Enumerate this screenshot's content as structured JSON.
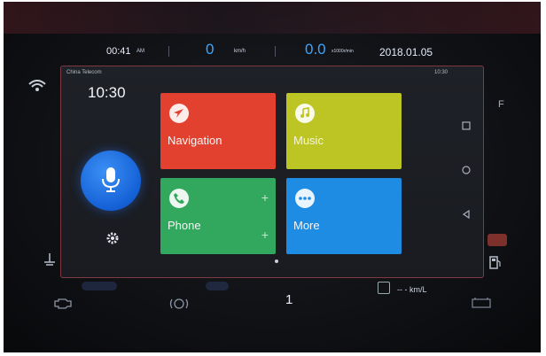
{
  "cluster": {
    "time": "00:41",
    "ampm": "AM",
    "speed": "0",
    "speed_unit": "km/h",
    "rpm": "0.0",
    "rpm_unit": "x1000r/min",
    "date": "2018.01.05"
  },
  "screen": {
    "status_left": "China Telecom",
    "status_right": "10:30",
    "clock": "10:30"
  },
  "tiles": [
    {
      "label": "Navigation",
      "icon": "navigation-arrow-icon",
      "color": "#e2412f"
    },
    {
      "label": "Music",
      "icon": "music-note-icon",
      "color": "#bcc524"
    },
    {
      "label": "Phone",
      "icon": "phone-icon",
      "color": "#32a85e"
    },
    {
      "label": "More",
      "icon": "more-dots-icon",
      "color": "#1f8ce4"
    }
  ],
  "bottom": {
    "gear": "1",
    "range": "-- - km/L"
  },
  "colors": {
    "accent_blue": "#3aa6ff",
    "mic": "#1460d6"
  }
}
